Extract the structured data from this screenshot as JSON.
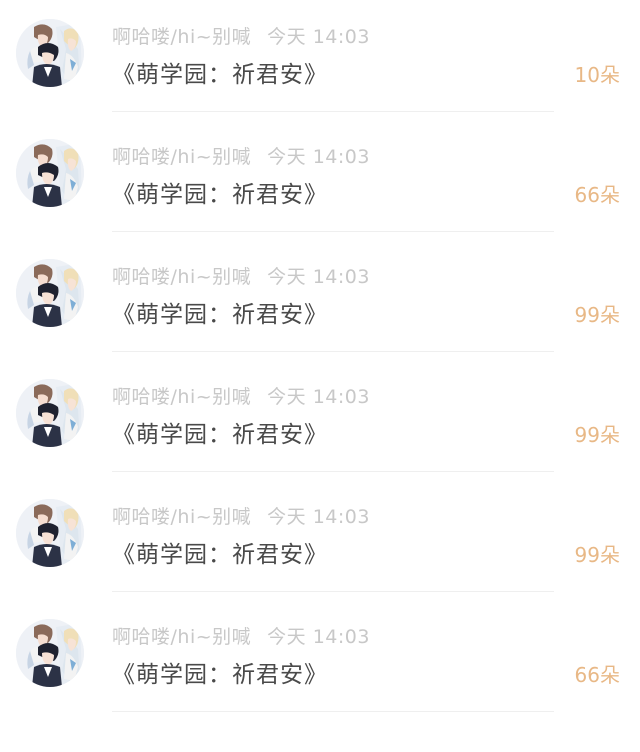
{
  "feed": {
    "items": [
      {
        "username": "啊哈喽/hi~别喊",
        "time": "今天 14:03",
        "title": "《萌学园：祈君安》",
        "amount": "10朵"
      },
      {
        "username": "啊哈喽/hi~别喊",
        "time": "今天 14:03",
        "title": "《萌学园：祈君安》",
        "amount": "66朵"
      },
      {
        "username": "啊哈喽/hi~别喊",
        "time": "今天 14:03",
        "title": "《萌学园：祈君安》",
        "amount": "99朵"
      },
      {
        "username": "啊哈喽/hi~别喊",
        "time": "今天 14:03",
        "title": "《萌学园：祈君安》",
        "amount": "99朵"
      },
      {
        "username": "啊哈喽/hi~别喊",
        "time": "今天 14:03",
        "title": "《萌学园：祈君安》",
        "amount": "99朵"
      },
      {
        "username": "啊哈喽/hi~别喊",
        "time": "今天 14:03",
        "title": "《萌学园：祈君安》",
        "amount": "66朵"
      }
    ]
  },
  "colors": {
    "meta": "#c8c8c8",
    "title": "#4a4a4a",
    "amount": "#e8b886",
    "divider": "#efefef"
  },
  "icons": {
    "avatar": "anime-characters-avatar"
  }
}
